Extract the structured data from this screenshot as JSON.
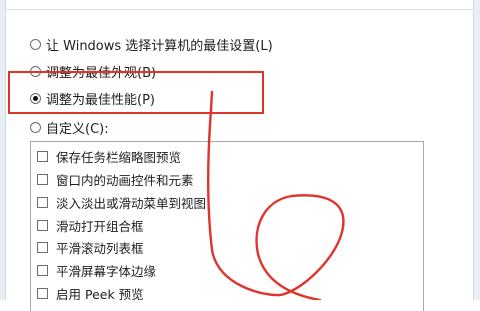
{
  "performance_options": {
    "radio_options": [
      {
        "label": "让 Windows 选择计算机的最佳设置(L)",
        "selected": false
      },
      {
        "label": "调整为最佳外观(B)",
        "selected": false
      },
      {
        "label": "调整为最佳性能(P)",
        "selected": true
      },
      {
        "label": "自定义(C):",
        "selected": false
      }
    ],
    "custom_effects": [
      {
        "label": "保存任务栏缩略图预览",
        "checked": false
      },
      {
        "label": "窗口内的动画控件和元素",
        "checked": false
      },
      {
        "label": "淡入淡出或滑动菜单到视图",
        "checked": false
      },
      {
        "label": "滑动打开组合框",
        "checked": false
      },
      {
        "label": "平滑滚动列表框",
        "checked": false
      },
      {
        "label": "平滑屏幕字体边缘",
        "checked": false
      },
      {
        "label": "启用 Peek 预览",
        "checked": false
      }
    ]
  },
  "annotation": {
    "color": "#e0332c"
  }
}
